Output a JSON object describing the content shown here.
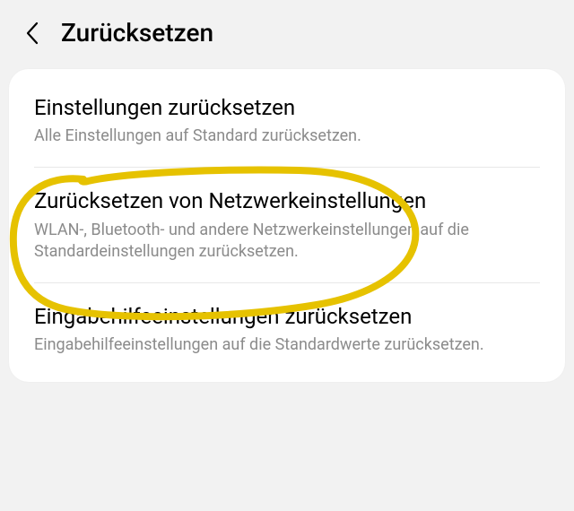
{
  "header": {
    "title": "Zurücksetzen"
  },
  "items": [
    {
      "title": "Einstellungen zurücksetzen",
      "subtitle": "Alle Einstellungen auf Standard zurücksetzen."
    },
    {
      "title": "Zurücksetzen von Netzwerkeinstellungen",
      "subtitle": "WLAN-, Bluetooth- und andere Netzwerkeinstellungen auf die Standardeinstellungen zurücksetzen."
    },
    {
      "title": "Eingabehilfeeinstellungen zurücksetzen",
      "subtitle": "Eingabehilfeeinstellungen auf die Standardwerte zurücksetzen."
    }
  ],
  "annotation": {
    "color": "#e6c200"
  }
}
